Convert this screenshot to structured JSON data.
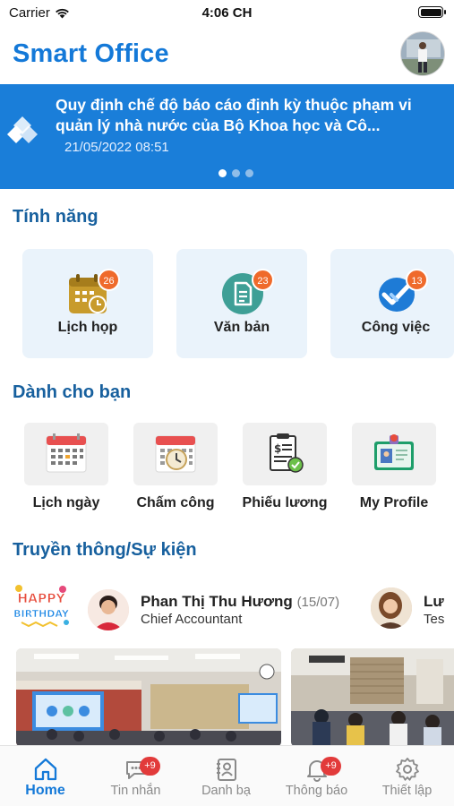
{
  "status_bar": {
    "carrier": "Carrier",
    "time": "4:06 CH"
  },
  "header": {
    "title": "Smart Office"
  },
  "banner": {
    "title": "Quy định chế độ báo cáo định kỳ thuộc phạm vi quản lý nhà nước của Bộ Khoa học và Cô...",
    "date": "21/05/2022 08:51",
    "pages": 3,
    "active_page": 1
  },
  "features": {
    "title": "Tính năng",
    "items": [
      {
        "label": "Lịch họp",
        "badge": "26",
        "icon": "calendar-clock-icon"
      },
      {
        "label": "Văn bản",
        "badge": "23",
        "icon": "document-icon"
      },
      {
        "label": "Công việc",
        "badge": "13",
        "icon": "double-check-icon"
      }
    ]
  },
  "for_you": {
    "title": "Dành cho bạn",
    "items": [
      {
        "label": "Lịch ngày",
        "icon": "calendar-icon"
      },
      {
        "label": "Chấm công",
        "icon": "calendar-clock-icon"
      },
      {
        "label": "Phiếu lương",
        "icon": "payslip-icon"
      },
      {
        "label": "My Profile",
        "icon": "id-card-icon"
      }
    ]
  },
  "events": {
    "title": "Truyền thông/Sự kiện",
    "sticker_text": [
      "HAPPY",
      "BIRTHDAY"
    ],
    "people": [
      {
        "name": "Phan Thị Thu Hương",
        "date": "(15/07)",
        "role": "Chief Accountant"
      },
      {
        "name": "Lư",
        "role": "Tes"
      }
    ]
  },
  "tab_bar": {
    "tabs": [
      {
        "label": "Home",
        "icon": "home-icon",
        "active": true
      },
      {
        "label": "Tin nhắn",
        "icon": "chat-icon",
        "badge": "+9"
      },
      {
        "label": "Danh bạ",
        "icon": "contacts-icon"
      },
      {
        "label": "Thông báo",
        "icon": "bell-icon",
        "badge": "+9"
      },
      {
        "label": "Thiết lập",
        "icon": "settings-icon"
      }
    ]
  },
  "colors": {
    "brand": "#1479d8",
    "section_title": "#17609e",
    "banner_bg": "#1a7ed9",
    "badge": "#ef6a2b",
    "tab_badge": "#e23b3b"
  }
}
